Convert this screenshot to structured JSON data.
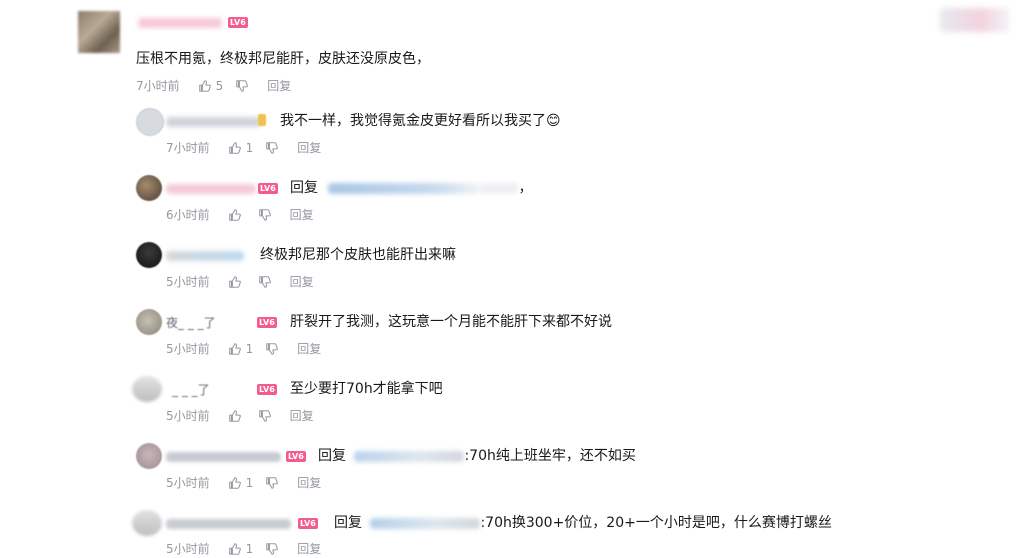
{
  "main_comment": {
    "level": "LV6",
    "text": "压根不用氪，终极邦尼能肝，皮肤还没原皮色，",
    "time": "7小时前",
    "likes": "5",
    "reply_label": "回复"
  },
  "replies": [
    {
      "level": "",
      "prefix": "",
      "text": "我不一样，我觉得氪金皮更好看所以我买了",
      "emoji": "😊",
      "time": "7小时前",
      "likes": "1",
      "reply_label": "回复"
    },
    {
      "level": "LV6",
      "prefix": "回复",
      "text": "，",
      "time": "6小时前",
      "likes": "",
      "reply_label": "回复"
    },
    {
      "level": "",
      "prefix": "",
      "text": "终极邦尼那个皮肤也能肝出来嘛",
      "time": "5小时前",
      "likes": "",
      "reply_label": "回复"
    },
    {
      "level": "LV6",
      "name_visible": "夜_ _ _了",
      "prefix": "",
      "text": "肝裂开了我测，这玩意一个月能不能肝下来都不好说",
      "time": "5小时前",
      "likes": "1",
      "reply_label": "回复"
    },
    {
      "level": "LV6",
      "name_visible": "_ _ _了",
      "prefix": "",
      "text": "至少要打70h才能拿下吧",
      "time": "5小时前",
      "likes": "",
      "reply_label": "回复"
    },
    {
      "level": "LV6",
      "prefix": "回复",
      "text": ":70h纯上班坐牢，还不如买",
      "time": "5小时前",
      "likes": "1",
      "reply_label": "回复"
    },
    {
      "level": "LV6",
      "prefix": "回复",
      "text": ":70h换300+价位，20+一个小时是吧，什么赛博打螺丝",
      "time": "5小时前",
      "likes": "1",
      "reply_label": "回复"
    }
  ],
  "colors": {
    "level_badge": "#f25d8e",
    "meta_text": "#9499a0",
    "comment_text": "#18191c"
  },
  "icons": {
    "like": "thumbs-up-icon",
    "dislike": "thumbs-down-icon"
  }
}
